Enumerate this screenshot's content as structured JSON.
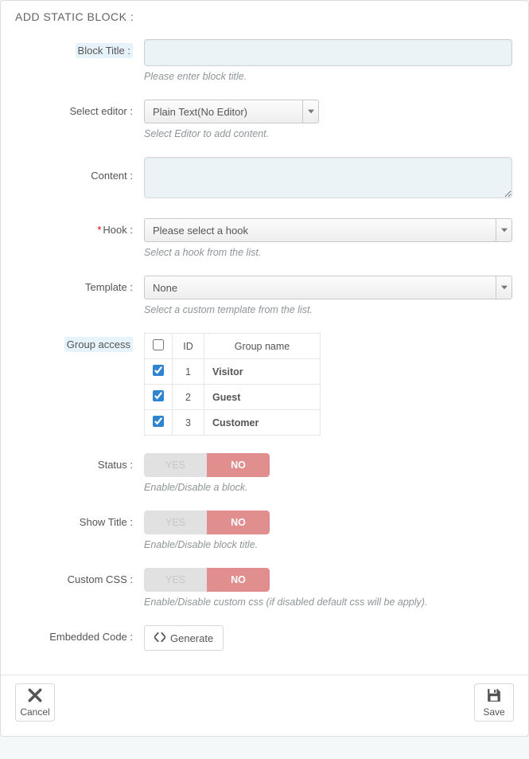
{
  "panel": {
    "title": "ADD STATIC BLOCK :"
  },
  "labels": {
    "block_title": "Block Title :",
    "select_editor": "Select editor :",
    "content": "Content :",
    "hook": "Hook :",
    "template": "Template :",
    "group_access": "Group access",
    "status": "Status :",
    "show_title": "Show Title :",
    "custom_css": "Custom CSS :",
    "embedded_code": "Embedded Code :"
  },
  "help": {
    "block_title": "Please enter block title.",
    "select_editor": "Select Editor to add content.",
    "hook": "Select a hook from the list.",
    "template": "Select a custom template from the list.",
    "status": "Enable/Disable a block.",
    "show_title": "Enable/Disable block title.",
    "custom_css": "Enable/Disable custom css (if disabled default css will be apply)."
  },
  "select_editor": {
    "value": "Plain Text(No Editor)"
  },
  "hook": {
    "placeholder": "Please select a hook"
  },
  "template": {
    "value": "None"
  },
  "group_access": {
    "cols": {
      "id": "ID",
      "name": "Group name"
    },
    "rows": [
      {
        "checked": true,
        "id": "1",
        "name": "Visitor"
      },
      {
        "checked": true,
        "id": "2",
        "name": "Guest"
      },
      {
        "checked": true,
        "id": "3",
        "name": "Customer"
      }
    ]
  },
  "toggle": {
    "yes": "YES",
    "no": "NO"
  },
  "status": {
    "value": "NO"
  },
  "show_title": {
    "value": "NO"
  },
  "custom_css": {
    "value": "NO"
  },
  "generate_btn": "Generate",
  "footer": {
    "cancel": "Cancel",
    "save": "Save"
  }
}
